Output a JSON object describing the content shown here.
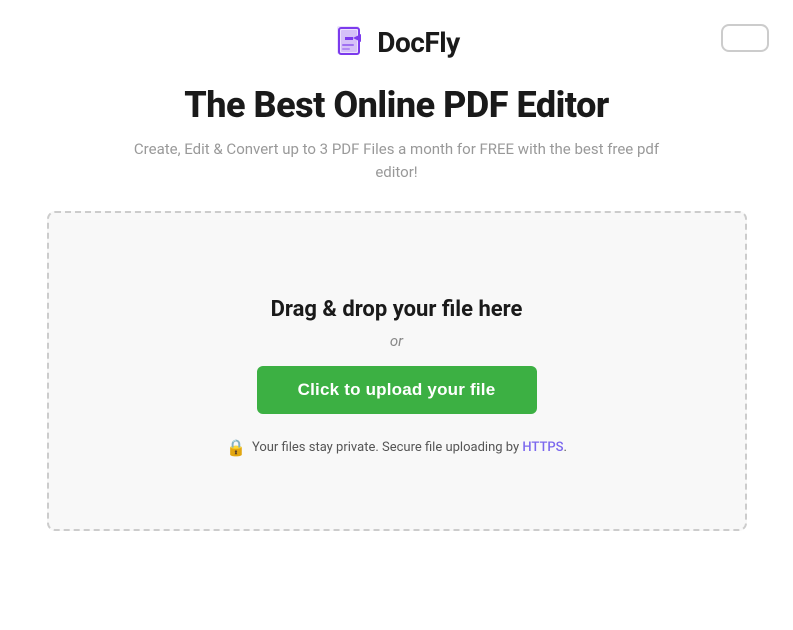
{
  "header": {
    "logo_text": "DocFly",
    "top_right_button_label": ""
  },
  "hero": {
    "main_title": "The Best Online PDF Editor",
    "subtitle": "Create, Edit & Convert up to 3 PDF Files a month for FREE with the best free pdf editor!"
  },
  "upload": {
    "drag_drop_label": "Drag & drop your file here",
    "or_label": "or",
    "upload_button_label": "Click to upload your file",
    "security_line_before": "Your files stay private. Secure file uploading by ",
    "security_https": "HTTPS",
    "security_period": "."
  }
}
